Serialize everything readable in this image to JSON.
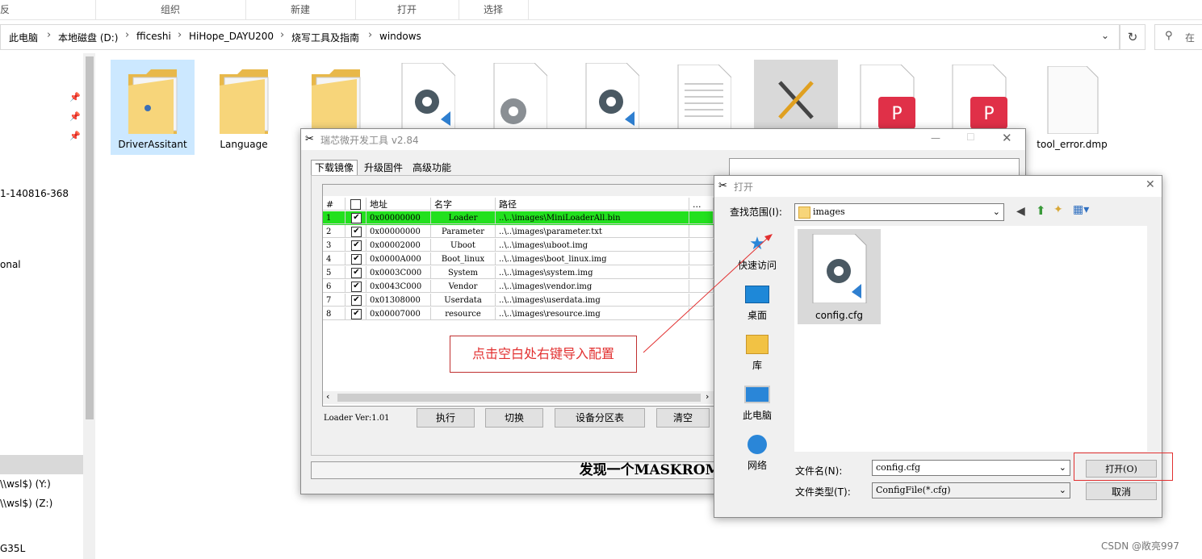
{
  "ribbon": {
    "tabs": [
      "反",
      "组织",
      "新建",
      "打开",
      "选择"
    ]
  },
  "address": {
    "crumbs": [
      "此电脑",
      "本地磁盘 (D:)",
      "fficeshi",
      "HiHope_DAYU200",
      "烧写工具及指南",
      "windows"
    ],
    "search_placeholder": "在"
  },
  "nav": {
    "items": [
      "1-140816-368",
      "onal",
      "\\\\wsl$) (Y:)",
      "\\\\wsl$) (Z:)",
      "G35L"
    ]
  },
  "files": [
    {
      "name": "DriverAssitant",
      "icon": "folder-icon"
    },
    {
      "name": "Language",
      "icon": "folder-icon"
    },
    {
      "name": "",
      "icon": "folder-icon"
    },
    {
      "name": "",
      "icon": "gear-file-icon"
    },
    {
      "name": "",
      "icon": "gear-file-icon"
    },
    {
      "name": "",
      "icon": "gear-file-icon"
    },
    {
      "name": "",
      "icon": "text-file-icon"
    },
    {
      "name": "",
      "icon": "tool-exe-icon"
    },
    {
      "name": "",
      "icon": "pdf-file-icon"
    },
    {
      "name": "",
      "icon": "pdf-file-icon"
    },
    {
      "name": "tool_error.dmp",
      "icon": "blank-file-icon"
    }
  ],
  "rk_tool": {
    "title": "瑞芯微开发工具 v2.84",
    "tabs": [
      "下载镜像",
      "升级固件",
      "高级功能"
    ],
    "columns": [
      "#",
      "",
      "地址",
      "名字",
      "路径",
      "..."
    ],
    "rows": [
      {
        "num": "1",
        "addr": "0x00000000",
        "name": "Loader",
        "path": "..\\..\\images\\MiniLoaderAll.bin"
      },
      {
        "num": "2",
        "addr": "0x00000000",
        "name": "Parameter",
        "path": "..\\..\\images\\parameter.txt"
      },
      {
        "num": "3",
        "addr": "0x00002000",
        "name": "Uboot",
        "path": "..\\..\\images\\uboot.img"
      },
      {
        "num": "4",
        "addr": "0x0000A000",
        "name": "Boot_linux",
        "path": "..\\..\\images\\boot_linux.img"
      },
      {
        "num": "5",
        "addr": "0x0003C000",
        "name": "System",
        "path": "..\\..\\images\\system.img"
      },
      {
        "num": "6",
        "addr": "0x0043C000",
        "name": "Vendor",
        "path": "..\\..\\images\\vendor.img"
      },
      {
        "num": "7",
        "addr": "0x01308000",
        "name": "Userdata",
        "path": "..\\..\\images\\userdata.img"
      },
      {
        "num": "8",
        "addr": "0x00007000",
        "name": "resource",
        "path": "..\\..\\images\\resource.img"
      }
    ],
    "loader_ver": "Loader Ver:1.01",
    "buttons": {
      "run": "执行",
      "switch": "切换",
      "partition": "设备分区表",
      "clear": "清空"
    },
    "status": "发现一个MASKROM设备",
    "annotation": "点击空白处右键导入配置",
    "colors": {
      "selected_row": "#22e01e",
      "annotation_red": "#e23030"
    }
  },
  "open_dialog": {
    "title": "打开",
    "lookin_label": "查找范围(I):",
    "lookin_value": "images",
    "sidebar": [
      "快速访问",
      "桌面",
      "库",
      "此电脑",
      "网络"
    ],
    "file": "config.cfg",
    "filename_label": "文件名(N):",
    "filename_value": "config.cfg",
    "filetype_label": "文件类型(T):",
    "filetype_value": "ConfigFile(*.cfg)",
    "open_button": "打开(O)",
    "cancel_button": "取消"
  },
  "watermark": "CSDN @敞亮997"
}
